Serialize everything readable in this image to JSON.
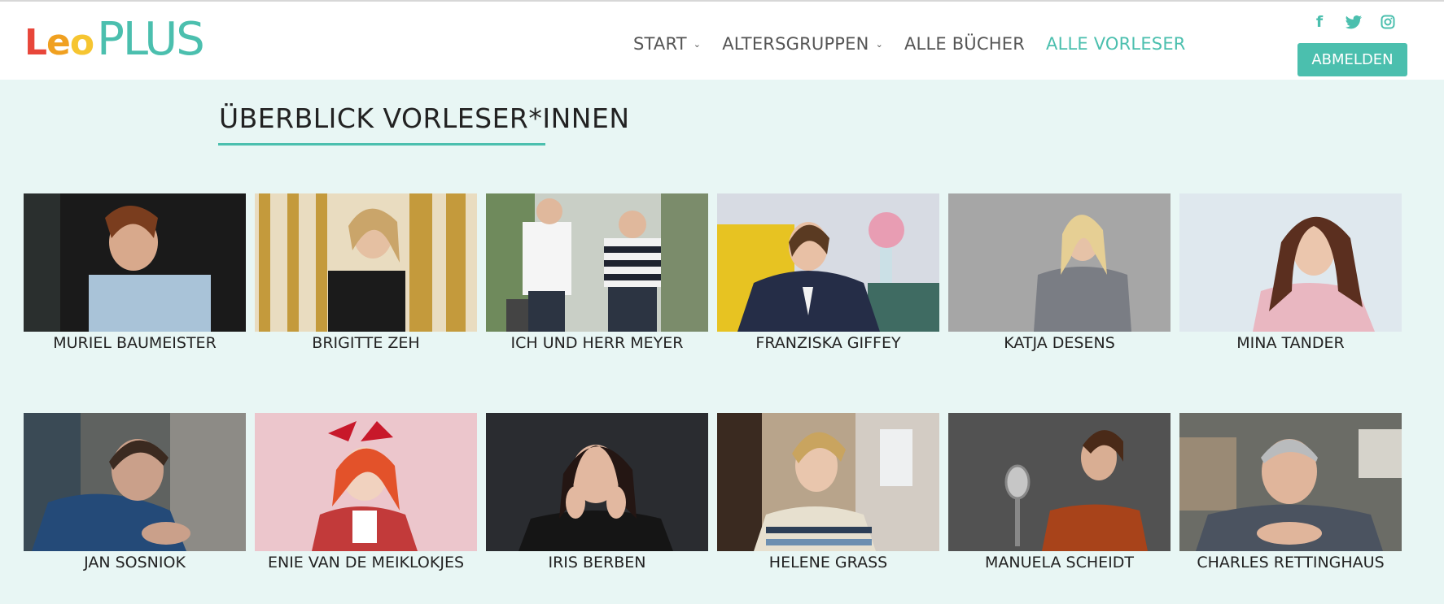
{
  "logo": {
    "leo": [
      "L",
      "e",
      "o"
    ],
    "plus": "PLUS",
    "leo_colors": [
      "#e8463a",
      "#f0a020",
      "#f6c531"
    ]
  },
  "nav": {
    "items": [
      {
        "label": "START",
        "dropdown": true,
        "active": false
      },
      {
        "label": "ALTERSGRUPPEN",
        "dropdown": true,
        "active": false
      },
      {
        "label": "ALLE BÜCHER",
        "dropdown": false,
        "active": false
      },
      {
        "label": "ALLE VORLESER",
        "dropdown": false,
        "active": true
      }
    ]
  },
  "social": [
    "facebook-icon",
    "twitter-icon",
    "instagram-icon"
  ],
  "logout_label": "ABMELDEN",
  "page_title": "ÜBERBLICK VORLESER*INNEN",
  "colors": {
    "accent": "#4bbfae",
    "background": "#e8f6f4"
  },
  "readers": [
    {
      "name": "MURIEL BAUMEISTER"
    },
    {
      "name": "BRIGITTE ZEH"
    },
    {
      "name": "ICH UND HERR MEYER"
    },
    {
      "name": "FRANZISKA GIFFEY"
    },
    {
      "name": "KATJA DESENS"
    },
    {
      "name": "MINA TANDER"
    },
    {
      "name": "JAN SOSNIOK"
    },
    {
      "name": "ENIE VAN DE MEIKLOKJES"
    },
    {
      "name": "IRIS BERBEN"
    },
    {
      "name": "HELENE GRASS"
    },
    {
      "name": "MANUELA SCHEIDT"
    },
    {
      "name": "CHARLES RETTINGHAUS"
    }
  ]
}
